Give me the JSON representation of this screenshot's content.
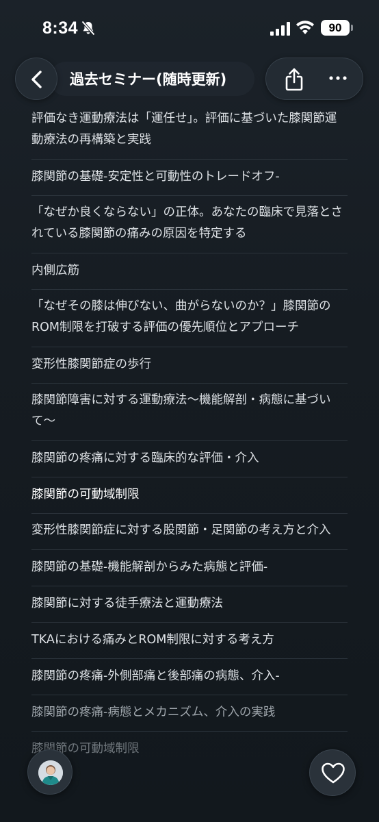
{
  "status_bar": {
    "time": "8:34",
    "battery": "90"
  },
  "header": {
    "title": "過去セミナー(随時更新)",
    "icons": [
      "chevron-left-icon",
      "share-icon",
      "more-icon"
    ]
  },
  "seminars": [
    "評価なき運動療法は「運任せ」。評価に基づいた膝関節運動療法の再構築と実践",
    "膝関節の基礎-安定性と可動性のトレードオフ-",
    "「なぜか良くならない」の正体。あなたの臨床で見落とされている膝関節の痛みの原因を特定する",
    "内側広筋",
    "「なぜその膝は伸びない、曲がらないのか？」膝関節のROM制限を打破する評価の優先順位とアプローチ",
    "変形性膝関節症の歩行",
    "膝関節障害に対する運動療法〜機能解剖・病態に基づいて〜",
    "膝関節の疼痛に対する臨床的な評価・介入",
    "膝関節の可動域制限",
    "変形性膝関節症に対する股関節・足関節の考え方と介入",
    "膝関節の基礎-機能解剖からみた病態と評価-",
    "膝関節に対する徒手療法と運動療法",
    "TKAにおける痛みとROM制限に対する考え方",
    "膝関節の疼痛-外側部痛と後部痛の病態、介入-",
    "膝関節の疼痛-病態とメカニズム、介入の実践",
    "膝関節の可動域制限"
  ],
  "floating": {
    "avatar_icon": "avatar-icon",
    "like_icon": "heart-icon"
  }
}
